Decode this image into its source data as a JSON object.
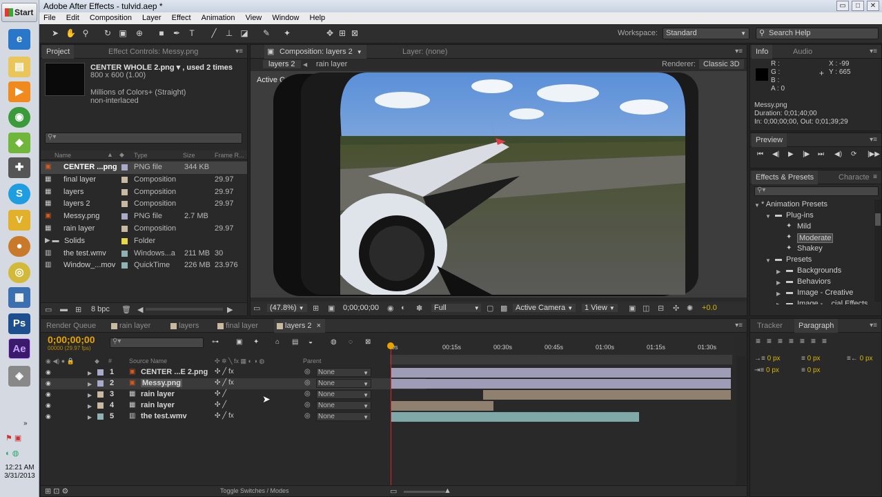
{
  "window": {
    "title": "Adobe After Effects - tulvid.aep *"
  },
  "menu": [
    "File",
    "Edit",
    "Composition",
    "Layer",
    "Effect",
    "Animation",
    "View",
    "Window",
    "Help"
  ],
  "taskbar": {
    "start_label": "Start",
    "time": "12:21 AM",
    "date": "3/31/2013"
  },
  "toolbar": {
    "workspace_label": "Workspace:",
    "workspace_value": "Standard",
    "search_placeholder": "Search Help"
  },
  "project": {
    "tab_project": "Project",
    "tab_effect_controls": "Effect Controls: Messy.png",
    "selected_name": "CENTER WHOLE 2.png ▾ , used 2 times",
    "selected_size": "800 x 600 (1.00)",
    "selected_colors": "Millions of Colors+ (Straight)",
    "selected_interlace": "non-interlaced",
    "columns": {
      "name": "Name",
      "type": "Type",
      "size": "Size",
      "frame_rate": "Frame R..."
    },
    "items": [
      {
        "name": "CENTER ...png",
        "type": "PNG file",
        "size": "344 KB",
        "fps": "",
        "icon": "png",
        "label_color": "#a9a9c9"
      },
      {
        "name": "final layer",
        "type": "Composition",
        "size": "",
        "fps": "29.97",
        "icon": "comp",
        "label_color": "#c9b9a0"
      },
      {
        "name": "layers",
        "type": "Composition",
        "size": "",
        "fps": "29.97",
        "icon": "comp",
        "label_color": "#c9b9a0"
      },
      {
        "name": "layers 2",
        "type": "Composition",
        "size": "",
        "fps": "29.97",
        "icon": "comp",
        "label_color": "#c9b9a0"
      },
      {
        "name": "Messy.png",
        "type": "PNG file",
        "size": "2.7 MB",
        "fps": "",
        "icon": "png",
        "label_color": "#a9a9c9"
      },
      {
        "name": "rain layer",
        "type": "Composition",
        "size": "",
        "fps": "29.97",
        "icon": "comp",
        "label_color": "#c9b9a0"
      },
      {
        "name": "Solids",
        "type": "Folder",
        "size": "",
        "fps": "",
        "icon": "folder",
        "label_color": "#e6d84a"
      },
      {
        "name": "the test.wmv",
        "type": "Windows...a",
        "size": "211 MB",
        "fps": "30",
        "icon": "video",
        "label_color": "#8fb3b3"
      },
      {
        "name": "Window_...mov",
        "type": "QuickTime",
        "size": "226 MB",
        "fps": "23.976",
        "icon": "video",
        "label_color": "#8fb3b3"
      }
    ],
    "bpc": "8 bpc"
  },
  "composition": {
    "tab_label": "Composition: layers 2",
    "layer_tab": "Layer: (none)",
    "breadcrumb": [
      "layers 2",
      "rain layer"
    ],
    "renderer_label": "Renderer:",
    "renderer_value": "Classic 3D",
    "view_label": "Active Camera",
    "footer": {
      "zoom": "(47.8%)",
      "timecode": "0;00;00;00",
      "resolution": "Full",
      "camera": "Active Camera",
      "views": "1 View",
      "exposure": "+0.0"
    }
  },
  "info": {
    "tab_info": "Info",
    "tab_audio": "Audio",
    "r": "R :",
    "g": "G :",
    "b": "B :",
    "a": "A : 0",
    "x": "X : -99",
    "y": "Y : 665",
    "file": "Messy.png",
    "duration": "Duration: 0;01;40;00",
    "inout": "In: 0;00;00;00, Out: 0;01;39;29"
  },
  "preview": {
    "tab": "Preview"
  },
  "effects": {
    "tab": "Effects & Presets",
    "tab2": "Characte",
    "tree": [
      {
        "label": "* Animation Presets",
        "indent": 0,
        "arrow": "▼",
        "icon": "none"
      },
      {
        "label": "Plug-ins",
        "indent": 1,
        "arrow": "▼",
        "icon": "folder"
      },
      {
        "label": "Mild",
        "indent": 2,
        "arrow": "",
        "icon": "preset"
      },
      {
        "label": "Moderate",
        "indent": 2,
        "arrow": "",
        "icon": "preset",
        "selected": true
      },
      {
        "label": "Shakey",
        "indent": 2,
        "arrow": "",
        "icon": "preset"
      },
      {
        "label": "Presets",
        "indent": 1,
        "arrow": "▼",
        "icon": "folder"
      },
      {
        "label": "Backgrounds",
        "indent": 2,
        "arrow": "▶",
        "icon": "folder"
      },
      {
        "label": "Behaviors",
        "indent": 2,
        "arrow": "▶",
        "icon": "folder"
      },
      {
        "label": "Image - Creative",
        "indent": 2,
        "arrow": "▶",
        "icon": "folder"
      },
      {
        "label": "Image - ...cial Effects",
        "indent": 2,
        "arrow": "▶",
        "icon": "folder"
      }
    ]
  },
  "timeline": {
    "tabs": [
      "Render Queue",
      "rain layer",
      "layers",
      "final layer",
      "layers 2"
    ],
    "timecode": "0;00;00;00",
    "fps_note": "00000 (29.97 fps)",
    "col_source": "Source Name",
    "col_parent": "Parent",
    "ruler": [
      "0s",
      "00:15s",
      "00:30s",
      "00:45s",
      "01:00s",
      "01:15s",
      "01:30s"
    ],
    "layers": [
      {
        "num": "1",
        "name": "CENTER ...E 2.png",
        "parent": "None",
        "label_color": "#a9a9c9",
        "icon": "png",
        "fx": true,
        "bar_color": "#9f9cb8",
        "bar_start": 0.0,
        "bar_end": 1.0
      },
      {
        "num": "2",
        "name": "Messy.png",
        "parent": "None",
        "label_color": "#a9a9c9",
        "icon": "png",
        "fx": true,
        "bar_color": "#9f9cb8",
        "bar_start": 0.0,
        "bar_end": 1.0,
        "selected": true
      },
      {
        "num": "3",
        "name": "rain layer",
        "parent": "None",
        "label_color": "#c9b9a0",
        "icon": "comp",
        "fx": false,
        "bar_color": "#8f8070",
        "bar_start": 0.27,
        "bar_end": 1.0
      },
      {
        "num": "4",
        "name": "rain layer",
        "parent": "None",
        "label_color": "#c9b9a0",
        "icon": "comp",
        "fx": false,
        "bar_color": "#8f8070",
        "bar_start": 0.0,
        "bar_end": 0.3
      },
      {
        "num": "5",
        "name": "the test.wmv",
        "parent": "None",
        "label_color": "#8fb3b3",
        "icon": "video",
        "fx": true,
        "bar_color": "#7fa9a9",
        "bar_start": 0.0,
        "bar_end": 0.73
      }
    ],
    "toggle_label": "Toggle Switches / Modes"
  },
  "tracker": {
    "tab": "Tracker",
    "tab_paragraph": "Paragraph",
    "val": "0 px"
  }
}
